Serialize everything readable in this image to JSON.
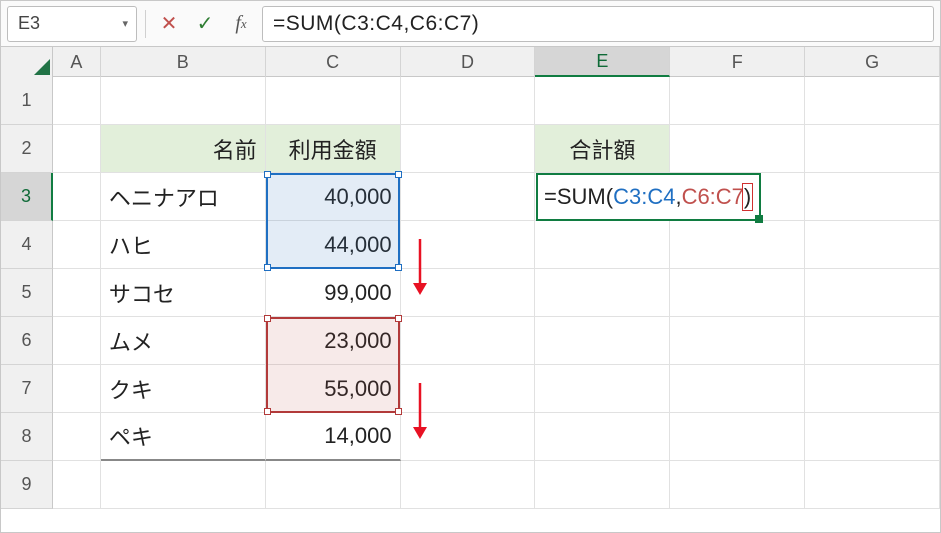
{
  "formula_bar": {
    "cell_ref": "E3",
    "formula_text": "=SUM(C3:C4,C6:C7)"
  },
  "columns": [
    "A",
    "B",
    "C",
    "D",
    "E",
    "F",
    "G"
  ],
  "rows": [
    "1",
    "2",
    "3",
    "4",
    "5",
    "6",
    "7",
    "8",
    "9"
  ],
  "headers": {
    "name": "名前",
    "amount": "利用金額",
    "total": "合計額"
  },
  "table": [
    {
      "name": "ヘニナアロ",
      "amount": "40,000"
    },
    {
      "name": "ハヒ",
      "amount": "44,000"
    },
    {
      "name": "サコセ",
      "amount": "99,000"
    },
    {
      "name": "ムメ",
      "amount": "23,000"
    },
    {
      "name": "クキ",
      "amount": "55,000"
    },
    {
      "name": "ペキ",
      "amount": "14,000"
    }
  ],
  "edit_formula": {
    "eq": "=",
    "fn": "SUM",
    "open": "(",
    "r1": "C3:C4",
    "comma": ",",
    "r2": "C6:C7",
    "close": ")"
  },
  "active": {
    "col": "E",
    "row": "3"
  },
  "selections": [
    {
      "name": "range1",
      "range": "C3:C4",
      "color": "blue"
    },
    {
      "name": "range2",
      "range": "C6:C7",
      "color": "red"
    }
  ]
}
